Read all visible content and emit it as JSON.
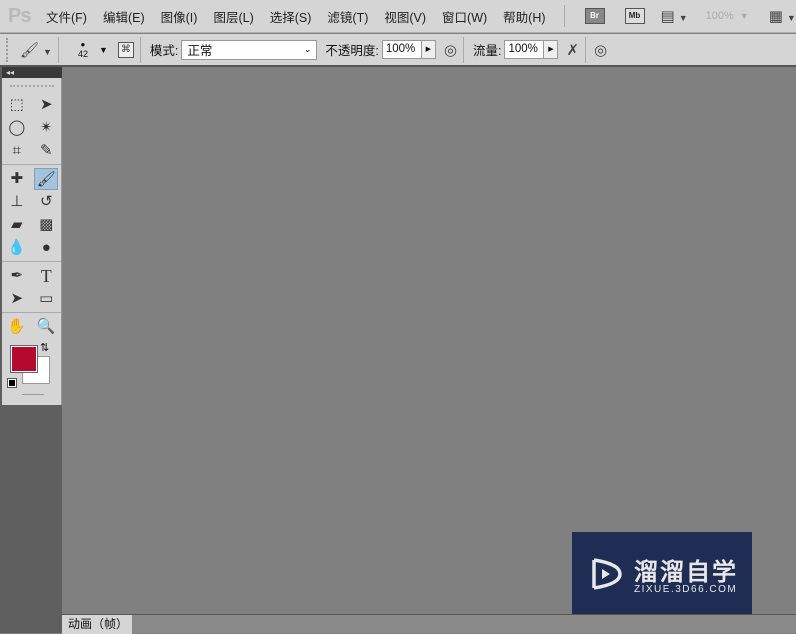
{
  "app": {
    "logo": "Ps"
  },
  "menu": [
    "文件(F)",
    "编辑(E)",
    "图像(I)",
    "图层(L)",
    "选择(S)",
    "滤镜(T)",
    "视图(V)",
    "窗口(W)",
    "帮助(H)"
  ],
  "appbar": {
    "br": "Br",
    "mb": "Mb",
    "zoom": "100%"
  },
  "options": {
    "brush_size": "42",
    "mode_label": "模式:",
    "mode_value": "正常",
    "opacity_label": "不透明度:",
    "opacity_value": "100%",
    "flow_label": "流量:",
    "flow_value": "100%"
  },
  "toolbar": {
    "collapse": "◂◂",
    "fg_color": "#b5092d",
    "bg_color": "#ffffff"
  },
  "panel": {
    "tab": "动画（帧）"
  },
  "watermark": {
    "title": "溜溜自学",
    "url": "ZIXUE.3D66.COM"
  }
}
